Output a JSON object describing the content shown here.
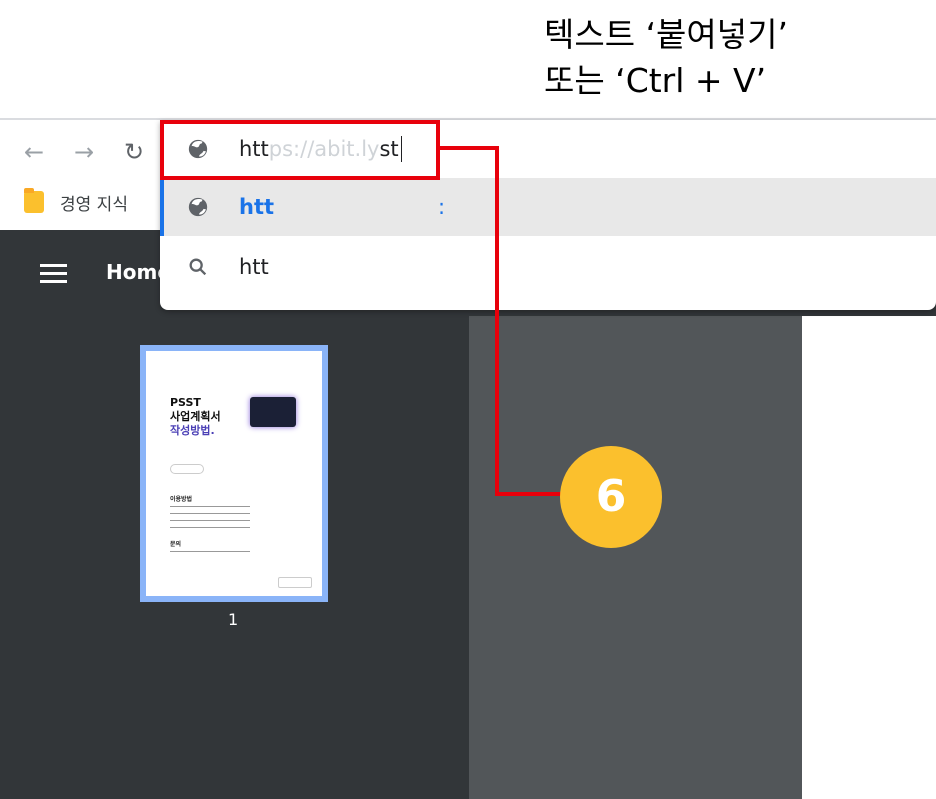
{
  "caption": {
    "line1": "텍스트 ‘붙여넣기’",
    "line2": "또는 ‘Ctrl + V’"
  },
  "toolbar": {
    "back_icon": "arrow-left-icon",
    "forward_icon": "arrow-right-icon",
    "reload_icon": "reload-icon",
    "bookmark_label": "경영 지식"
  },
  "omnibox": {
    "input_typed": "htt",
    "input_ghost": "ps://abit.ly",
    "input_end": "st",
    "suggestions": [
      {
        "icon": "globe-icon",
        "text": "htt",
        "tail": ":"
      },
      {
        "icon": "search-icon",
        "text": "htt"
      }
    ]
  },
  "step": {
    "number": "6"
  },
  "pdf": {
    "title": "Home",
    "thumbnail": {
      "heading_line1": "PSST",
      "heading_line2": "사업계획서",
      "heading_line3": "작성방법.",
      "section1": "이용방법",
      "section2": "문의"
    },
    "page_number": "1"
  },
  "colors": {
    "highlight_red": "#e8000b",
    "badge_yellow": "#fbc02d",
    "pdf_dark": "#323639",
    "pdf_gray": "#525659"
  }
}
